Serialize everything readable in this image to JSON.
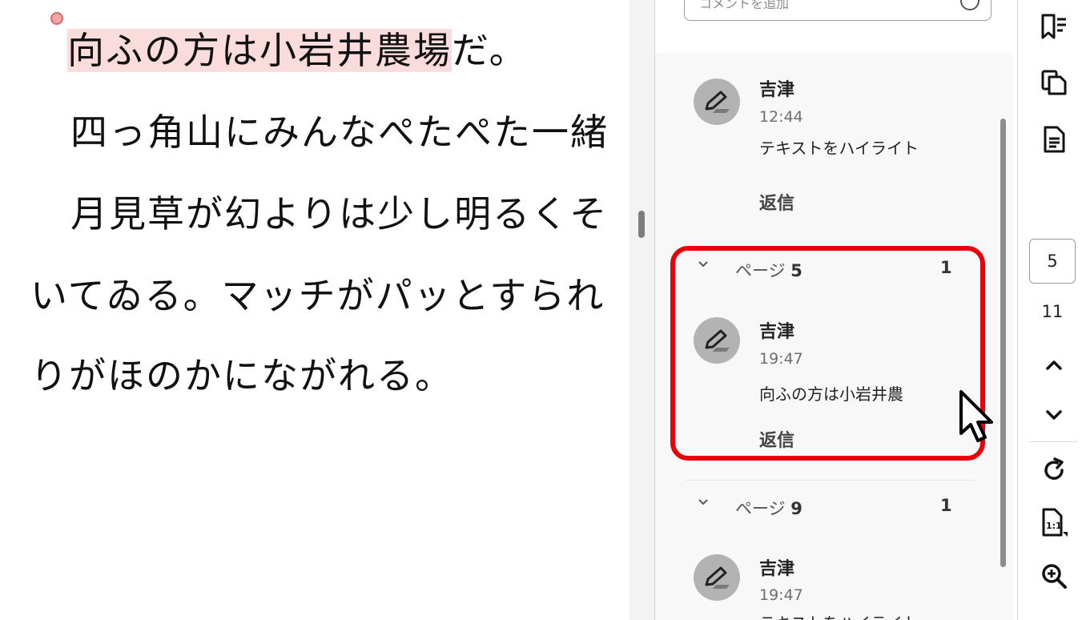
{
  "document": {
    "lines": [
      {
        "highlighted": "向ふの方は小岩井農場",
        "rest": "だ。"
      },
      {
        "text": "四っ角山にみんなぺたぺた一緒"
      },
      {
        "text": "月見草が幻よりは少し明るくそ"
      },
      {
        "text": "いてゐる。マッチがパッとすられ"
      },
      {
        "text": "りがほのかにながれる。"
      }
    ]
  },
  "comments_panel": {
    "input_placeholder": "コメントを追加",
    "top_comment": {
      "author": "吉津",
      "time": "12:44",
      "text": "テキストをハイライト",
      "reply_label": "返信"
    },
    "groups": [
      {
        "label": "ページ",
        "page": "5",
        "count": "1",
        "comment": {
          "author": "吉津",
          "time": "19:47",
          "text": "向ふの方は小岩井農",
          "reply_label": "返信"
        }
      },
      {
        "label": "ページ",
        "page": "9",
        "count": "1",
        "comment": {
          "author": "吉津",
          "time": "19:47",
          "text": "テキストをハイライト"
        }
      }
    ]
  },
  "toolbar": {
    "icons": [
      "bookmark-list-icon",
      "copy-pages-icon",
      "document-icon",
      "chevron-up-icon",
      "chevron-down-icon",
      "rotate-icon",
      "actual-size-icon",
      "zoom-in-icon"
    ],
    "current_page": "5",
    "total_pages": "11"
  },
  "colors": {
    "highlight": "#fbdcdc",
    "focus_box": "#e8000b",
    "avatar": "#b3b3b3"
  }
}
